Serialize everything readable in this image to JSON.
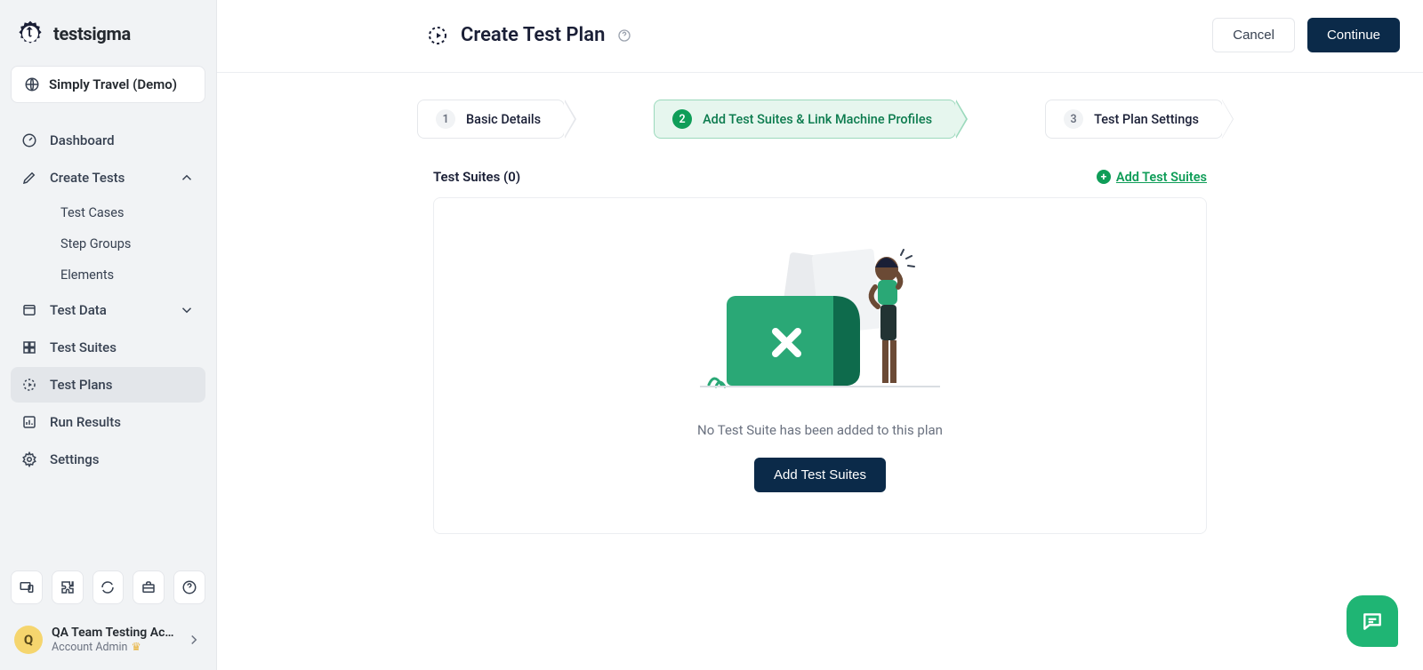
{
  "brand": {
    "name": "testsigma"
  },
  "project": {
    "label": "Simply Travel (Demo)"
  },
  "sidebar": {
    "items": [
      {
        "label": "Dashboard"
      },
      {
        "label": "Create Tests"
      },
      {
        "label": "Test Data"
      },
      {
        "label": "Test Suites"
      },
      {
        "label": "Test Plans"
      },
      {
        "label": "Run Results"
      },
      {
        "label": "Settings"
      }
    ],
    "create_tests_children": [
      {
        "label": "Test Cases"
      },
      {
        "label": "Step Groups"
      },
      {
        "label": "Elements"
      }
    ]
  },
  "user": {
    "avatar_letter": "Q",
    "name": "QA Team Testing Acc...",
    "role": "Account Admin"
  },
  "header": {
    "title": "Create Test Plan",
    "cancel": "Cancel",
    "continue": "Continue"
  },
  "stepper": {
    "steps": [
      {
        "num": "1",
        "label": "Basic Details"
      },
      {
        "num": "2",
        "label": "Add Test Suites & Link Machine Profiles"
      },
      {
        "num": "3",
        "label": "Test Plan Settings"
      }
    ]
  },
  "suites": {
    "heading": "Test Suites (0)",
    "add_link": "Add Test Suites",
    "empty_text": "No Test Suite has been added to this plan",
    "add_button": "Add Test Suites"
  }
}
